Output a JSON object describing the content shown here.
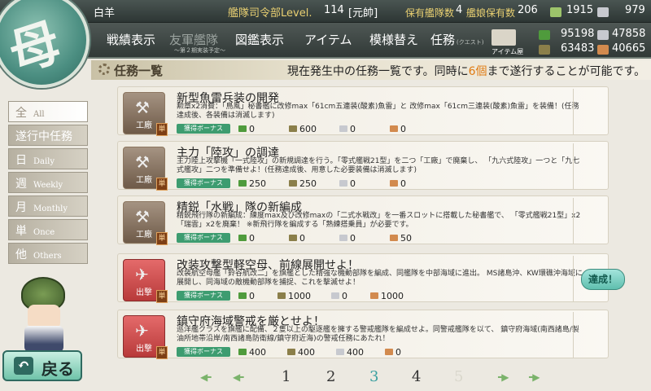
{
  "header": {
    "name": "白羊",
    "rank_label": "艦隊司令部Level.",
    "level": "114",
    "rank": "[元帥]",
    "ships_label": "保有艦隊数",
    "ships": "4",
    "girls_label": "艦娘保有数",
    "girls": "206",
    "bucket": "1915",
    "dev": "979"
  },
  "resources": {
    "fuel": "95198",
    "ammo": "63483",
    "steel": "47858",
    "bauxite": "40665"
  },
  "nav": {
    "record": "戦績表示",
    "friend": "友軍艦隊",
    "friend_sub": "～第２期実装予定～",
    "library": "図鑑表示",
    "item": "アイテム",
    "remodel": "模様替え",
    "quest": "任務",
    "quest_sub": "(クエスト)",
    "shop": "アイテム屋"
  },
  "page": {
    "title": "任務一覧",
    "notice_pre": "現在発生中の任務一覧です。同時に",
    "notice_num": "6個",
    "notice_post": "まで遂行することが可能です。"
  },
  "sidebar": [
    {
      "jp": "全",
      "en": "All"
    },
    {
      "jp": "遂行中任務",
      "en": ""
    },
    {
      "jp": "日",
      "en": "Daily"
    },
    {
      "jp": "週",
      "en": "Weekly"
    },
    {
      "jp": "月",
      "en": "Monthly"
    },
    {
      "jp": "単",
      "en": "Once"
    },
    {
      "jp": "他",
      "en": "Others"
    }
  ],
  "quests": [
    {
      "type": "工廠",
      "once": "単",
      "title": "新型魚雷兵装の開発",
      "desc": "勲章x2消費：「鳥風」秘書艦に改修max「61cm五連装(酸素)魚雷」と 改修max「61cm三連装(酸素)魚雷」を装備！(任務達成後、各装備は消滅します)",
      "bonus": "獲得ボーナス",
      "fuel": "0",
      "ammo": "600",
      "steel": "0",
      "baux": "0"
    },
    {
      "type": "工廠",
      "once": "単",
      "title": "主力「陸攻」の調達",
      "desc": "主力陸上攻撃機「一式陸攻」の新規調達を行う。「零式艦戦21型」を二つ「工廠」で廃棄し、 「九六式陸攻」一つと「九七式艦攻」二つを準備せよ！(任務達成後、用意した必要装備は消滅します)",
      "bonus": "獲得ボーナス",
      "fuel": "250",
      "ammo": "250",
      "steel": "0",
      "baux": "0"
    },
    {
      "type": "工廠",
      "once": "単",
      "title": "精鋭「水戦」隊の新編成",
      "desc": "精鋭飛行隊の新編成：練度max及び改修maxの「二式水戦改」を一番スロットに搭載した秘書艦で、 「零式艦戦21型」x2「瑞雲」x2を廃棄！ ※新飛行隊を編成する「熟練搭乗員」が必要です。",
      "bonus": "獲得ボーナス",
      "fuel": "0",
      "ammo": "0",
      "steel": "0",
      "baux": "50"
    },
    {
      "type": "出撃",
      "once": "単",
      "title": "改装攻撃型軽空母、前線展開せよ！",
      "desc": "改装航空母艦「鈴谷航改二」を旗艦とした精強な機動部隊を編成、同艦隊を中部海域に進出。 MS諸島沖、KW環礁沖海域に展開し、同海域の敵機動部隊を捕捉、これを撃滅せよ！",
      "bonus": "獲得ボーナス",
      "fuel": "0",
      "ammo": "1000",
      "steel": "0",
      "baux": "1000",
      "achieve": "達成！"
    },
    {
      "type": "出撃",
      "once": "単",
      "title": "鎮守府海域警戒を厳とせよ！",
      "desc": "巡洋艦クラスを旗艦に配備、２隻以上の駆逐艦を擁する警戒艦隊を編成せよ。同警戒艦隊を以て、 鎮守府海域(南西諸島/製油所地帯沿岸/南西諸島防衛線/鎮守府近海)の警戒任務にあたれ！",
      "bonus": "獲得ボーナス",
      "fuel": "400",
      "ammo": "400",
      "steel": "400",
      "baux": "0"
    }
  ],
  "pager": {
    "pages": [
      "1",
      "2",
      "3",
      "4",
      "5"
    ],
    "current": "3"
  },
  "back": "戻る",
  "colors": {
    "accent": "#3aa0a0",
    "notice_num": "#e07a10",
    "bonus": "#3d9c70"
  }
}
